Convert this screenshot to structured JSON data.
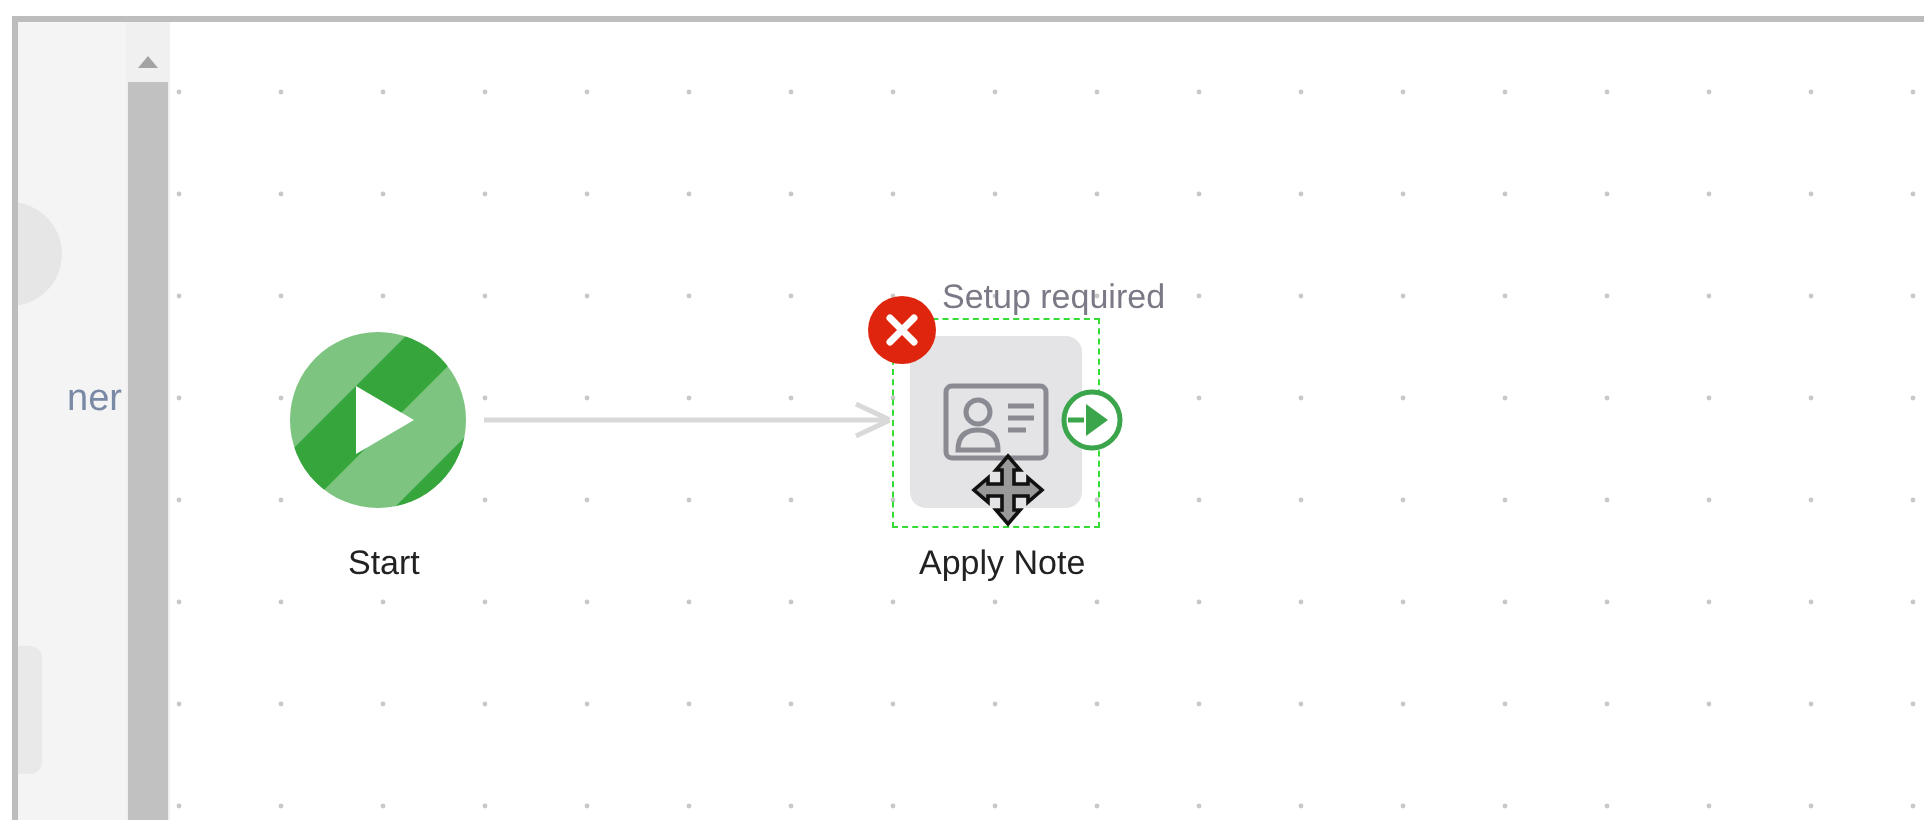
{
  "sidebar": {
    "item_text": "ner"
  },
  "nodes": [
    {
      "kind": "start",
      "label": "Start"
    },
    {
      "kind": "action",
      "label": "Apply Note",
      "status": "Setup required",
      "selected": true,
      "error": true
    }
  ]
}
